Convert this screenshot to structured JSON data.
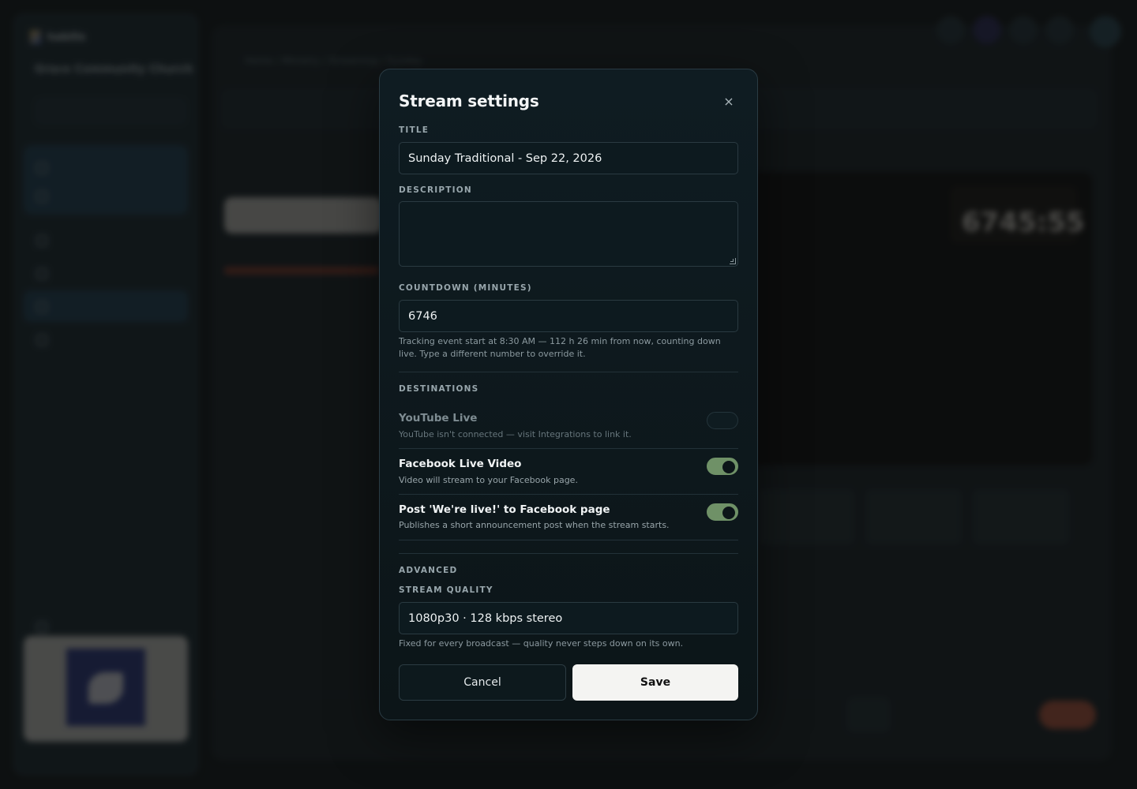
{
  "background": {
    "brand": "habilis",
    "church_name": "Grace Community Church",
    "crumbs": "Home  /  Ministry  /  Streaming  /  Sunday",
    "timer": "6745:55"
  },
  "modal": {
    "title": "Stream settings",
    "close_icon": "×",
    "title_field": {
      "label": "TITLE",
      "value": "Sunday Traditional - Sep 22, 2026"
    },
    "description_field": {
      "label": "DESCRIPTION",
      "value": ""
    },
    "countdown_field": {
      "label": "COUNTDOWN (MINUTES)",
      "value": "6746",
      "hint": "Tracking event start at 8:30 AM — 112 h 26 min from now, counting down live. Type a different number to override it."
    },
    "destinations": {
      "label": "DESTINATIONS",
      "items": [
        {
          "name": "YouTube Live",
          "desc": "YouTube isn't connected — visit Integrations to link it.",
          "enabled": false,
          "available": false
        },
        {
          "name": "Facebook Live Video",
          "desc": "Video will stream to your Facebook page.",
          "enabled": true,
          "available": true
        },
        {
          "name": "Post 'We're live!' to Facebook page",
          "desc": "Publishes a short announcement post when the stream starts.",
          "enabled": true,
          "available": true
        }
      ]
    },
    "advanced": {
      "label": "ADVANCED",
      "quality_label": "STREAM QUALITY",
      "quality_value": "1080p30 · 128 kbps stereo",
      "quality_hint": "Fixed for every broadcast — quality never steps down on its own."
    },
    "cancel_label": "Cancel",
    "save_label": "Save"
  },
  "colors": {
    "toggle_on": "#6f9167",
    "save_bg": "#f4f4f2",
    "modal_bg": "#0f1c22"
  }
}
